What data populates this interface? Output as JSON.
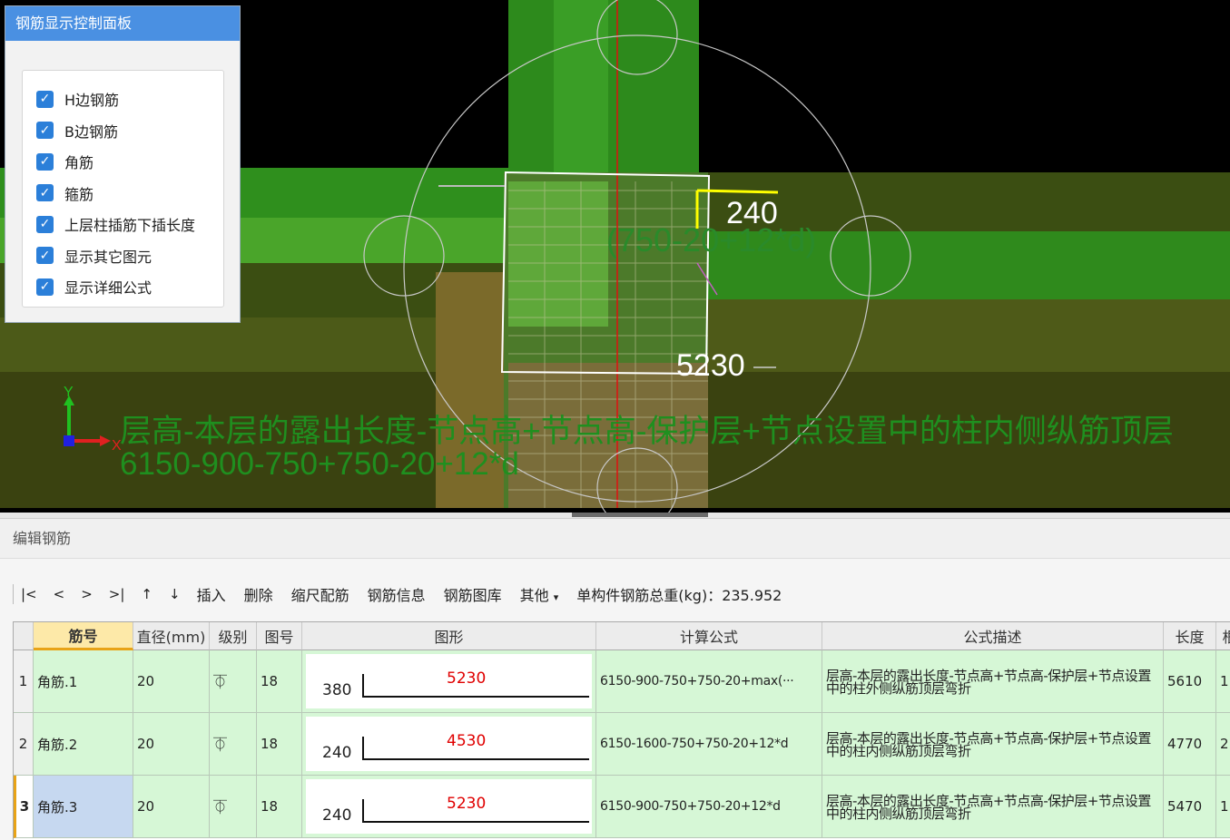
{
  "control_panel": {
    "title": "钢筋显示控制面板",
    "options": [
      {
        "label": "H边钢筋",
        "checked": true
      },
      {
        "label": "B边钢筋",
        "checked": true
      },
      {
        "label": "角筋",
        "checked": true
      },
      {
        "label": "箍筋",
        "checked": true
      },
      {
        "label": "上层柱插筋下插长度",
        "checked": true
      },
      {
        "label": "显示其它图元",
        "checked": true
      },
      {
        "label": "显示详细公式",
        "checked": true
      }
    ]
  },
  "viewport": {
    "dim_top": "240",
    "dim_formula": "(750-20+12*d)",
    "dim_bottom": "5230",
    "axis_y": "Y",
    "axis_x": "X",
    "formula_line1": "层高-本层的露出长度-节点高+节点高-保护层+节点设置中的柱内侧纵筋顶层",
    "formula_line2": "6150-900-750+750-20+12*d",
    "colors": {
      "beam": "#2f9e1f",
      "column": "#2a7d1a",
      "dim_text": "#ffffff",
      "formula": "#1f8f1f",
      "selection": "#ffffff"
    }
  },
  "editor": {
    "title": "编辑钢筋",
    "toolbar": {
      "nav_first": "|<",
      "nav_prev": "<",
      "nav_next": ">",
      "nav_last": ">|",
      "move_up": "↑",
      "move_down": "↓",
      "insert": "插入",
      "delete": "删除",
      "scale": "缩尺配筋",
      "info": "钢筋信息",
      "library": "钢筋图库",
      "other": "其他",
      "other_arrow": "▾",
      "total_weight": "单构件钢筋总重(kg)：235.952"
    },
    "columns": [
      "筋号",
      "直径(mm)",
      "级别",
      "图号",
      "图形",
      "计算公式",
      "公式描述",
      "长度",
      "根"
    ],
    "rows": [
      {
        "num": "1",
        "name": "角筋.1",
        "diameter": "20",
        "grade": "⏁",
        "fig": "18",
        "shape_left": "380",
        "shape_len": "5230",
        "formula": "6150-900-750+750-20+max(···",
        "desc": "层高-本层的露出长度-节点高+节点高-保护层+节点设置中的柱外侧纵筋顶层弯折",
        "length": "5610",
        "count": "1"
      },
      {
        "num": "2",
        "name": "角筋.2",
        "diameter": "20",
        "grade": "⏁",
        "fig": "18",
        "shape_left": "240",
        "shape_len": "4530",
        "formula": "6150-1600-750+750-20+12*d",
        "desc": "层高-本层的露出长度-节点高+节点高-保护层+节点设置中的柱内侧纵筋顶层弯折",
        "length": "4770",
        "count": "2"
      },
      {
        "num": "3",
        "name": "角筋.3",
        "diameter": "20",
        "grade": "⏁",
        "fig": "18",
        "shape_left": "240",
        "shape_len": "5230",
        "formula": "6150-900-750+750-20+12*d",
        "desc": "层高-本层的露出长度-节点高+节点高-保护层+节点设置中的柱内侧纵筋顶层弯折",
        "length": "5470",
        "count": "1"
      }
    ]
  }
}
